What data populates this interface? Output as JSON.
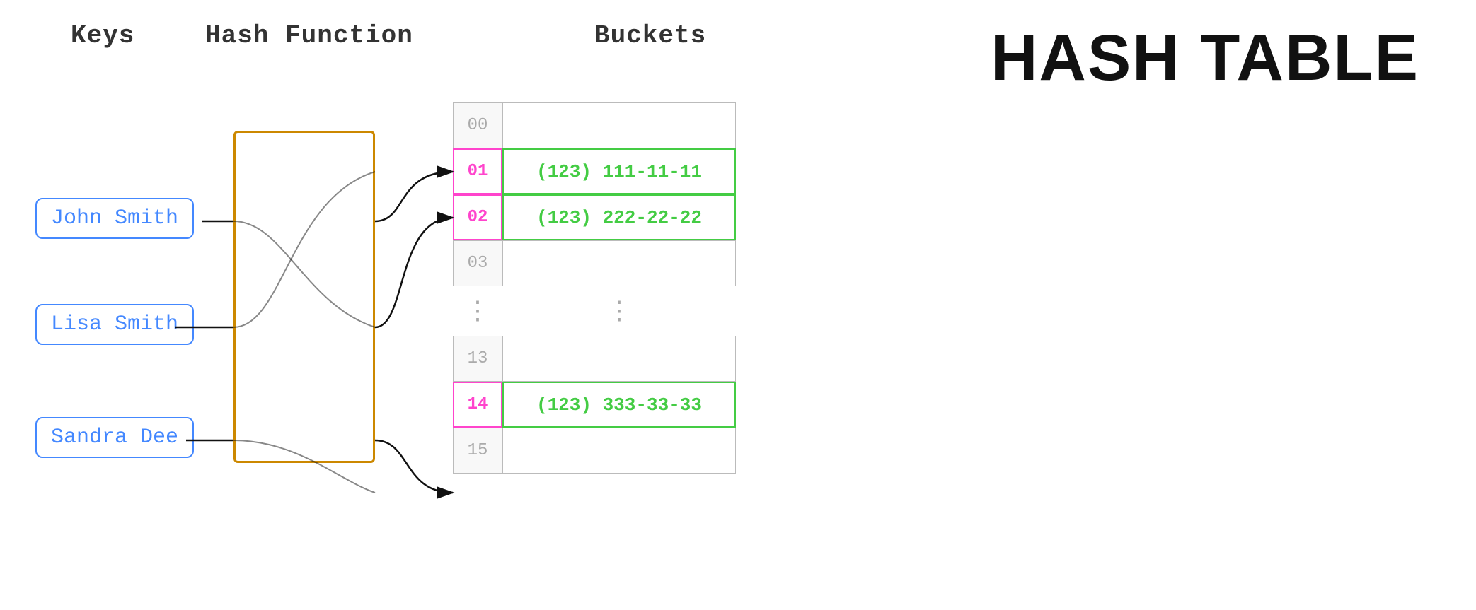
{
  "title": "Hash Table",
  "labels": {
    "keys": "Keys",
    "hashFunction": "Hash Function",
    "buckets": "Buckets"
  },
  "keys": [
    {
      "id": "john",
      "label": "John Smith"
    },
    {
      "id": "lisa",
      "label": "Lisa Smith"
    },
    {
      "id": "sandra",
      "label": "Sandra Dee"
    }
  ],
  "buckets_top": [
    {
      "index": "00",
      "value": "",
      "highlighted": false,
      "filled": false
    },
    {
      "index": "01",
      "value": "(123) 111-11-11",
      "highlighted": true,
      "filled": true
    },
    {
      "index": "02",
      "value": "(123) 222-22-22",
      "highlighted": true,
      "filled": true
    },
    {
      "index": "03",
      "value": "",
      "highlighted": false,
      "filled": false
    }
  ],
  "buckets_bottom": [
    {
      "index": "13",
      "value": "",
      "highlighted": false,
      "filled": false
    },
    {
      "index": "14",
      "value": "(123) 333-33-33",
      "highlighted": true,
      "filled": true
    },
    {
      "index": "15",
      "value": "",
      "highlighted": false,
      "filled": false
    }
  ]
}
